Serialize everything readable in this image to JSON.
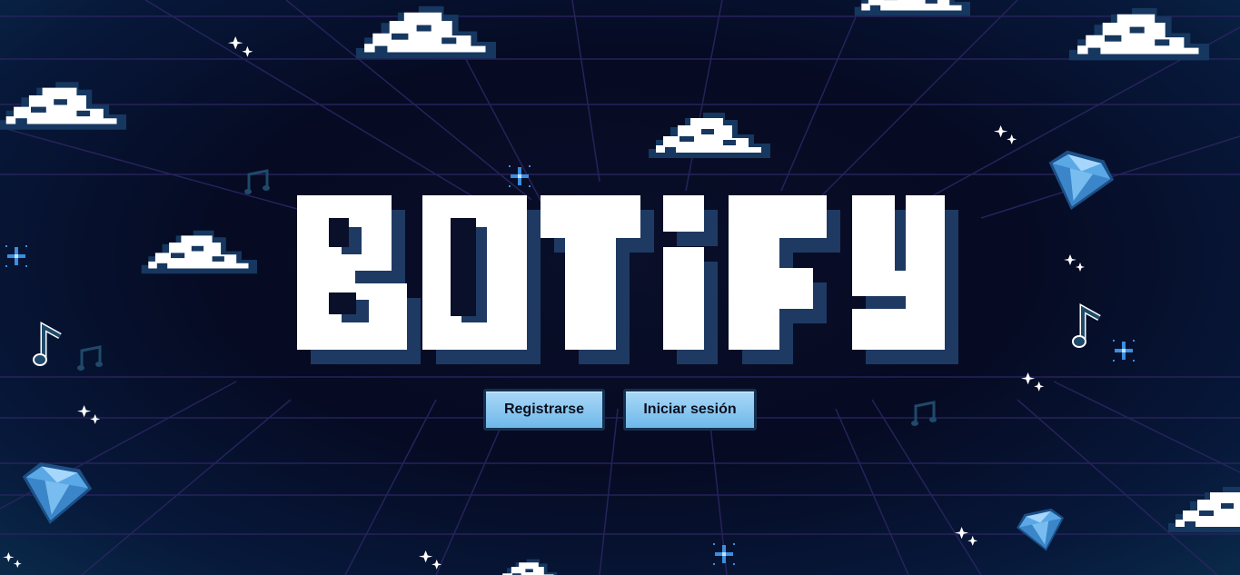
{
  "app": {
    "title": "BOTIFY"
  },
  "buttons": {
    "register_label": "Registrarse",
    "login_label": "Iniciar sesión"
  },
  "colors": {
    "background": "#060a22",
    "grid": "#2a2560",
    "button": "#8cc8f0",
    "cloud": "#ffffff",
    "cloud_shadow": "#16375f",
    "logo_shadow": "#1e3a62",
    "diamond": "#5aa9e6",
    "music_note": "#1f4a6a"
  },
  "decorations": [
    "cloud",
    "sparkle-icon",
    "music-note-icon",
    "diamond-icon"
  ]
}
